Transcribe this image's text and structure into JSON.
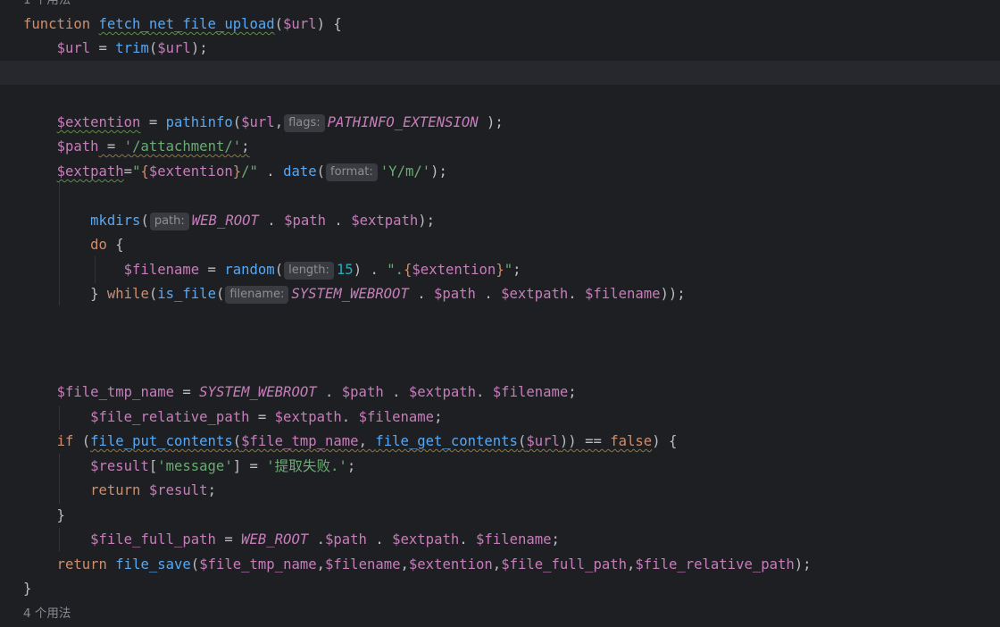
{
  "editor": {
    "usage_top": "1 个用法",
    "usage_bottom": "4 个用法",
    "hints": {
      "flags": "flags:",
      "format": "format:",
      "path": "path:",
      "length": "length:",
      "filename": "filename:"
    },
    "tokens": {
      "function_kw": "function",
      "function_name": "fetch_net_file_upload",
      "param_url": "$url",
      "trim": "trim",
      "var_url": "$url",
      "var_extention": "$extention",
      "pathinfo": "pathinfo",
      "pathinfo_ext": "PATHINFO_EXTENSION",
      "var_path": "$path",
      "str_attachment": "'/attachment/'",
      "var_extpath": "$extpath",
      "interp_ext": "$extention",
      "date": "date",
      "str_ymd": "'Y/m/'",
      "mkdirs": "mkdirs",
      "web_root": "WEB_ROOT",
      "do_kw": "do",
      "var_filename": "$filename",
      "random": "random",
      "num_15": "15",
      "while_kw": "while",
      "is_file": "is_file",
      "system_webroot": "SYSTEM_WEBROOT",
      "var_file_tmp_name": "$file_tmp_name",
      "var_file_relative_path": "$file_relative_path",
      "if_kw": "if",
      "file_put_contents": "file_put_contents",
      "file_get_contents": "file_get_contents",
      "false_kw": "false",
      "var_result": "$result",
      "str_message": "'message'",
      "str_fail": "'提取失败.'",
      "return_kw": "return",
      "var_file_full_path": "$file_full_path",
      "file_save": "file_save"
    }
  }
}
